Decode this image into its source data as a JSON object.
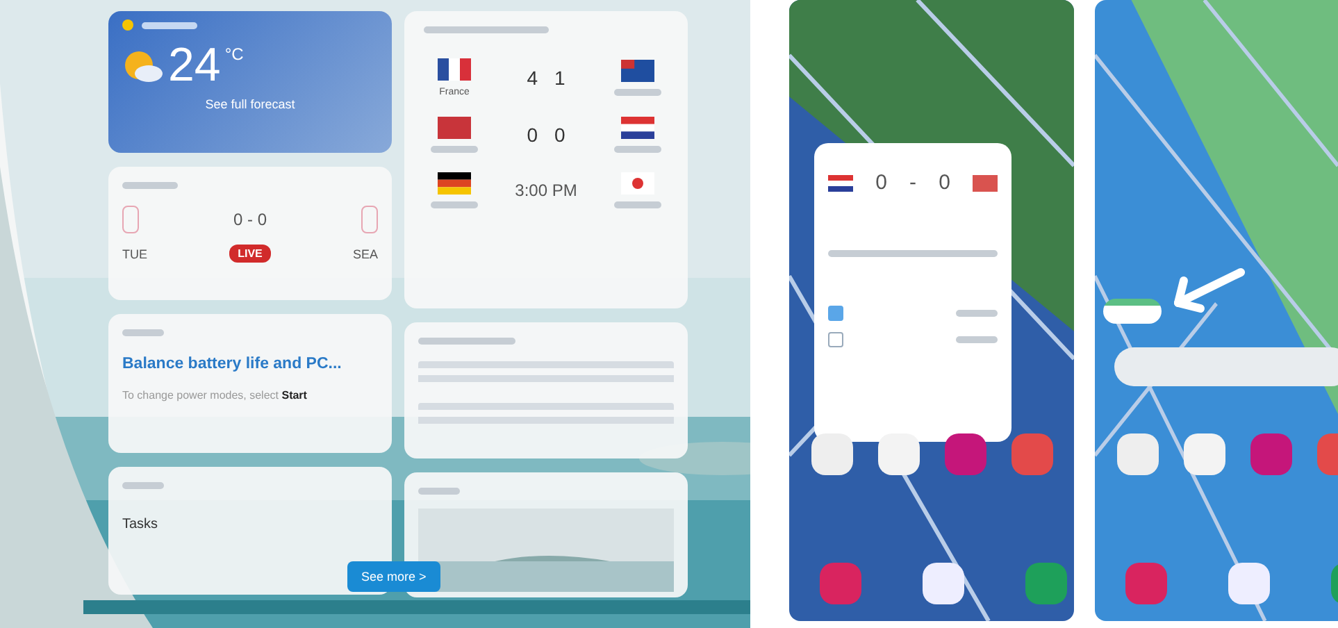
{
  "widgets_panel": {
    "weather": {
      "temperature": "24",
      "unit": "°C",
      "link": "See full forecast"
    },
    "sports": {
      "score": "0 - 0",
      "status": "LIVE",
      "teams": [
        "TUE",
        "SEA"
      ]
    },
    "soccer": {
      "matches": [
        {
          "kind": "result",
          "home": "France",
          "score_home": "4",
          "score_away": "1"
        },
        {
          "kind": "result",
          "score_home": "0",
          "score_away": "0"
        },
        {
          "kind": "upcoming",
          "time": "3:00 PM"
        }
      ]
    },
    "tips": {
      "headline": "Balance battery life and PC...",
      "body": "To change power modes, select **Start**"
    },
    "todo": {
      "list": "Tasks"
    },
    "see_more": "See more >"
  },
  "phones": [
    {
      "kind": "popup",
      "score_home": "0",
      "separator": "-",
      "score_away": "0",
      "options": [
        {
          "checked": true
        },
        {
          "checked": false
        }
      ]
    },
    {
      "kind": "home"
    }
  ]
}
